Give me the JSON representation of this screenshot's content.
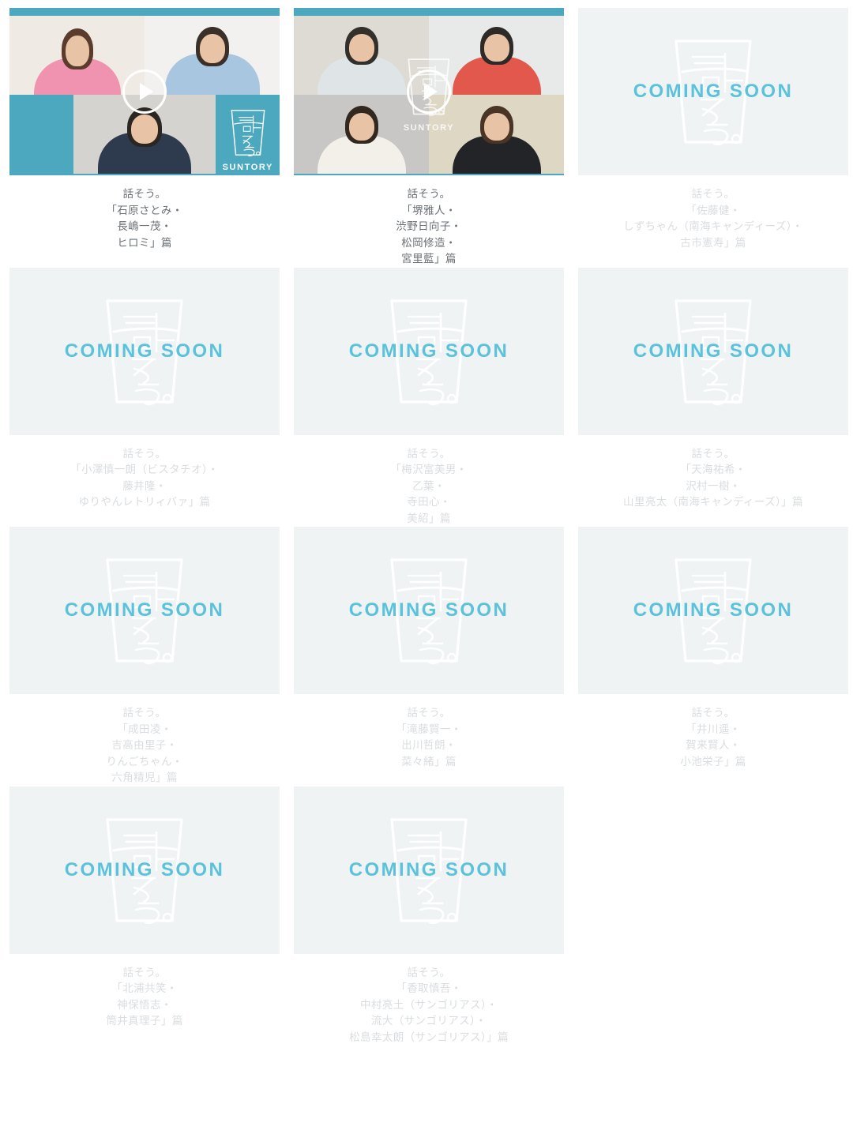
{
  "page": {
    "title": "話そう。 CM ギャラリー",
    "coming_soon_label": "COMING SOON",
    "brand_name": "SUNTORY",
    "logo_text": "話そう。",
    "play_icon": "play-icon",
    "colors": {
      "accent_cyan": "#5bc2dc",
      "thumbnail_teal": "#4ba8be",
      "card_background": "#eff3f4",
      "caption_text": "#6b7075",
      "caption_text_faded": "#d9dde0",
      "page_background": "#ffffff"
    }
  },
  "grid": {
    "columns": 3,
    "rows": 4,
    "items": [
      {
        "id": "item-1",
        "type": "video",
        "state": "published",
        "layout": "two-top-one-bottom",
        "caption_dim": false,
        "caption_lines": [
          "話そう。",
          "「石原さとみ・",
          "長嶋一茂・",
          "ヒロミ」篇"
        ]
      },
      {
        "id": "item-2",
        "type": "video",
        "state": "published",
        "layout": "quad",
        "caption_dim": false,
        "caption_lines": [
          "話そう。",
          "「堺雅人・",
          "渋野日向子・",
          "松岡修造・",
          "宮里藍」篇"
        ]
      },
      {
        "id": "item-3",
        "type": "coming-soon",
        "state": "coming-soon",
        "caption_dim": true,
        "caption_lines": [
          "話そう。",
          "「佐藤健・",
          "しずちゃん（南海キャンディーズ）・",
          "古市憲寿」篇"
        ]
      },
      {
        "id": "item-4",
        "type": "coming-soon",
        "state": "coming-soon",
        "caption_dim": true,
        "caption_lines": [
          "話そう。",
          "「小澤慎一朗（ビスタチオ）・",
          "藤井隆・",
          "ゆりやんレトリィバァ」篇"
        ]
      },
      {
        "id": "item-5",
        "type": "coming-soon",
        "state": "coming-soon",
        "caption_dim": true,
        "caption_lines": [
          "話そう。",
          "「梅沢富美男・",
          "乙葉・",
          "寺田心・",
          "美紹」篇"
        ]
      },
      {
        "id": "item-6",
        "type": "coming-soon",
        "state": "coming-soon",
        "caption_dim": true,
        "caption_lines": [
          "話そう。",
          "「天海祐希・",
          "沢村一樹・",
          "山里亮太（南海キャンディーズ）」篇"
        ]
      },
      {
        "id": "item-7",
        "type": "coming-soon",
        "state": "coming-soon",
        "caption_dim": true,
        "caption_lines": [
          "話そう。",
          "「成田凌・",
          "吉高由里子・",
          "りんごちゃん・",
          "六角精児」篇"
        ]
      },
      {
        "id": "item-8",
        "type": "coming-soon",
        "state": "coming-soon",
        "caption_dim": true,
        "caption_lines": [
          "話そう。",
          "「滝藤賢一・",
          "出川哲朗・",
          "菜々緒」篇"
        ]
      },
      {
        "id": "item-9",
        "type": "coming-soon",
        "state": "coming-soon",
        "caption_dim": true,
        "caption_lines": [
          "話そう。",
          "「井川遥・",
          "賀来賢人・",
          "小池栄子」篇"
        ]
      },
      {
        "id": "item-10",
        "type": "coming-soon",
        "state": "coming-soon",
        "caption_dim": true,
        "caption_lines": [
          "話そう。",
          "「北浦共笑・",
          "神保悟志・",
          "筒井真理子」篇"
        ]
      },
      {
        "id": "item-11",
        "type": "coming-soon",
        "state": "coming-soon",
        "caption_dim": true,
        "caption_lines": [
          "話そう。",
          "「香取慎吾・",
          "中村亮土（サンゴリアス）・",
          "流大（サンゴリアス）・",
          "松島幸太朗（サンゴリアス）」篇"
        ]
      },
      {
        "id": "item-12",
        "type": "empty",
        "state": "empty",
        "caption_dim": true,
        "caption_lines": []
      }
    ]
  }
}
